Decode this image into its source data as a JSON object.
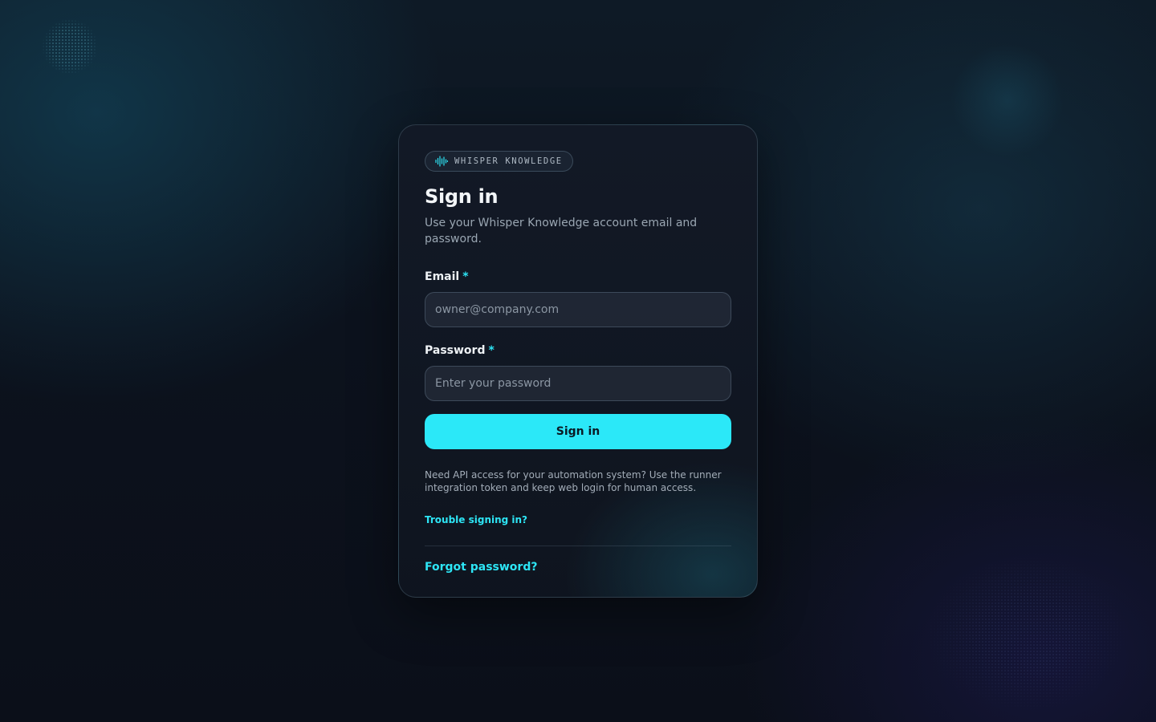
{
  "brand": {
    "name": "WHISPER KNOWLEDGE",
    "icon": "waveform-icon"
  },
  "header": {
    "title": "Sign in",
    "subtitle": "Use your Whisper Knowledge account email and password."
  },
  "form": {
    "email": {
      "label": "Email",
      "required_marker": "*",
      "placeholder": "owner@company.com",
      "value": ""
    },
    "password": {
      "label": "Password",
      "required_marker": "*",
      "placeholder": "Enter your password",
      "value": ""
    },
    "submit_label": "Sign in"
  },
  "footer": {
    "api_note": "Need API access for your automation system? Use the runner integration token and keep web login for human access.",
    "trouble_link": "Trouble signing in?",
    "forgot_link": "Forgot password?"
  },
  "colors": {
    "accent": "#2be8f8",
    "background": "#0b0f19",
    "card": "#131a26"
  }
}
